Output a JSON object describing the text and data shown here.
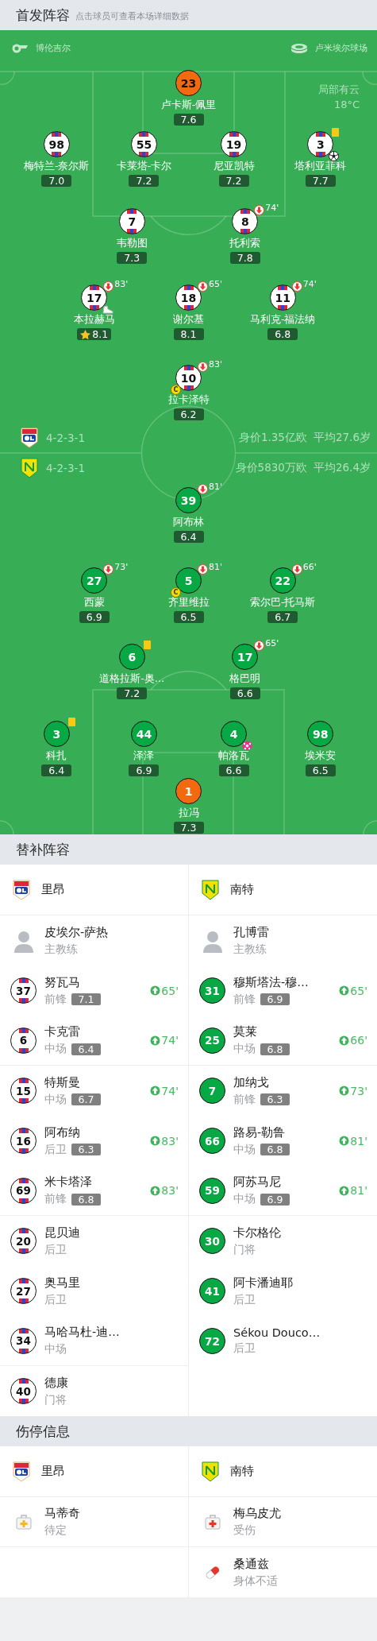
{
  "lineup": {
    "title": "首发阵容",
    "hint": "点击球员可查看本场详细数据"
  },
  "pitch": {
    "referee": "博伦吉尔",
    "venue": "卢米埃尔球场",
    "weather": "局部有云",
    "temperature": "18°C",
    "home": {
      "formation": "4-2-3-1",
      "value": "身价1.35亿欧",
      "age": "平均27.6岁",
      "lines": [
        [
          {
            "number": "23",
            "name": "卢卡斯-佩里",
            "rating": "7.6",
            "keeper": true,
            "top_rated": false
          }
        ],
        [
          {
            "number": "98",
            "name": "梅特兰-奈尔斯",
            "rating": "7.0",
            "keeper": false,
            "top_rated": false
          },
          {
            "number": "55",
            "name": "卡莱塔-卡尔",
            "rating": "7.2",
            "keeper": false,
            "top_rated": false
          },
          {
            "number": "19",
            "name": "尼亚凯特",
            "rating": "7.2",
            "keeper": false,
            "top_rated": false
          },
          {
            "number": "3",
            "name": "塔利亚菲科",
            "rating": "7.7",
            "keeper": false,
            "top_rated": false,
            "events": [
              {
                "kind": "yellow_card"
              },
              {
                "kind": "goal"
              }
            ]
          }
        ],
        [
          {
            "number": "7",
            "name": "韦勒图",
            "rating": "7.3",
            "keeper": false,
            "top_rated": false
          },
          {
            "number": "8",
            "name": "托利索",
            "rating": "7.8",
            "keeper": false,
            "top_rated": false,
            "events": [
              {
                "kind": "sub_off",
                "minute": "74'"
              }
            ]
          }
        ],
        [
          {
            "number": "17",
            "name": "本拉赫马",
            "rating": "8.1",
            "keeper": false,
            "top_rated": true,
            "events": [
              {
                "kind": "sub_off",
                "minute": "83'"
              },
              {
                "kind": "assist"
              }
            ]
          },
          {
            "number": "18",
            "name": "谢尔基",
            "rating": "8.1",
            "keeper": false,
            "top_rated": false,
            "events": [
              {
                "kind": "sub_off",
                "minute": "65'"
              }
            ]
          },
          {
            "number": "11",
            "name": "马利克-福法纳",
            "rating": "6.8",
            "keeper": false,
            "top_rated": false,
            "events": [
              {
                "kind": "sub_off",
                "minute": "74'"
              }
            ]
          }
        ],
        [
          {
            "number": "10",
            "name": "拉卡泽特",
            "rating": "6.2",
            "keeper": false,
            "armband": "C",
            "top_rated": false,
            "events": [
              {
                "kind": "sub_off",
                "minute": "83'"
              }
            ]
          }
        ]
      ]
    },
    "away": {
      "formation": "4-2-3-1",
      "value": "身价5830万欧",
      "age": "平均26.4岁",
      "lines": [
        [
          {
            "number": "39",
            "name": "阿布林",
            "rating": "6.4",
            "keeper": false,
            "top_rated": false,
            "events": [
              {
                "kind": "sub_off",
                "minute": "81'"
              }
            ]
          }
        ],
        [
          {
            "number": "27",
            "name": "西蒙",
            "rating": "6.9",
            "keeper": false,
            "top_rated": false,
            "events": [
              {
                "kind": "sub_off",
                "minute": "73'"
              }
            ]
          },
          {
            "number": "5",
            "name": "齐里维拉",
            "rating": "6.5",
            "keeper": false,
            "armband": "C",
            "top_rated": false,
            "events": [
              {
                "kind": "sub_off",
                "minute": "81'"
              }
            ]
          },
          {
            "number": "22",
            "name": "索尔巴-托马斯",
            "rating": "6.7",
            "keeper": false,
            "top_rated": false,
            "events": [
              {
                "kind": "sub_off",
                "minute": "66'"
              }
            ]
          }
        ],
        [
          {
            "number": "6",
            "name": "道格拉斯-奥…",
            "rating": "7.2",
            "keeper": false,
            "top_rated": false,
            "events": [
              {
                "kind": "yellow_card"
              }
            ]
          },
          {
            "number": "17",
            "name": "格巴明",
            "rating": "6.6",
            "keeper": false,
            "top_rated": false,
            "events": [
              {
                "kind": "sub_off",
                "minute": "65'"
              }
            ]
          }
        ],
        [
          {
            "number": "3",
            "name": "科扎",
            "rating": "6.4",
            "keeper": false,
            "top_rated": false,
            "events": [
              {
                "kind": "yellow_card"
              }
            ]
          },
          {
            "number": "44",
            "name": "泽泽",
            "rating": "6.9",
            "keeper": false,
            "top_rated": false
          },
          {
            "number": "4",
            "name": "帕洛瓦",
            "rating": "6.6",
            "keeper": false,
            "top_rated": false,
            "events": [
              {
                "kind": "own_goal"
              }
            ]
          },
          {
            "number": "98",
            "name": "埃米安",
            "rating": "6.5",
            "keeper": false,
            "top_rated": false
          }
        ],
        [
          {
            "number": "1",
            "name": "拉冯",
            "rating": "7.3",
            "keeper": true,
            "top_rated": false
          }
        ]
      ]
    }
  },
  "substitutes": {
    "title": "替补阵容",
    "teams": [
      {
        "name": "里昂",
        "kind": "home",
        "coach": {
          "name": "皮埃尔-萨热",
          "role": "主教练"
        },
        "players": [
          {
            "number": "37",
            "name": "努瓦马",
            "position": "前锋",
            "rating": "7.1",
            "minute": "65'"
          },
          {
            "number": "6",
            "name": "卡克雷",
            "position": "中场",
            "rating": "6.4",
            "minute": "74'"
          },
          {
            "number": "15",
            "name": "特斯曼",
            "position": "中场",
            "rating": "6.7",
            "minute": "74'"
          },
          {
            "number": "16",
            "name": "阿布纳",
            "position": "后卫",
            "rating": "6.3",
            "minute": "83'"
          },
          {
            "number": "69",
            "name": "米卡塔泽",
            "position": "前锋",
            "rating": "6.8",
            "minute": "83'"
          },
          {
            "number": "20",
            "name": "昆贝迪",
            "position": "后卫"
          },
          {
            "number": "27",
            "name": "奥马里",
            "position": "后卫"
          },
          {
            "number": "34",
            "name": "马哈马杜-迪…",
            "position": "中场"
          },
          {
            "number": "40",
            "name": "德康",
            "position": "门将"
          }
        ]
      },
      {
        "name": "南特",
        "kind": "away",
        "coach": {
          "name": "孔博雷",
          "role": "主教练"
        },
        "players": [
          {
            "number": "31",
            "name": "穆斯塔法-穆…",
            "position": "前锋",
            "rating": "6.9",
            "minute": "65'"
          },
          {
            "number": "25",
            "name": "莫莱",
            "position": "中场",
            "rating": "6.8",
            "minute": "66'"
          },
          {
            "number": "7",
            "name": "加纳戈",
            "position": "前锋",
            "rating": "6.3",
            "minute": "73'"
          },
          {
            "number": "66",
            "name": "路易-勒鲁",
            "position": "中场",
            "rating": "6.8",
            "minute": "81'"
          },
          {
            "number": "59",
            "name": "阿苏马尼",
            "position": "中场",
            "rating": "6.9",
            "minute": "81'"
          },
          {
            "number": "30",
            "name": "卡尔格伦",
            "position": "门将"
          },
          {
            "number": "41",
            "name": "阿卡潘迪耶",
            "position": "后卫"
          },
          {
            "number": "72",
            "name": "Sékou Douco…",
            "position": "后卫"
          }
        ]
      }
    ]
  },
  "injuries": {
    "title": "伤停信息",
    "teams": [
      {
        "name": "里昂",
        "kind": "home",
        "players": [
          {
            "name": "马蒂奇",
            "status": "待定",
            "kind": "doubtful"
          }
        ]
      },
      {
        "name": "南特",
        "kind": "away",
        "players": [
          {
            "name": "梅乌皮尤",
            "status": "受伤",
            "kind": "injury"
          },
          {
            "name": "桑通兹",
            "status": "身体不适",
            "kind": "illness"
          }
        ]
      }
    ]
  }
}
